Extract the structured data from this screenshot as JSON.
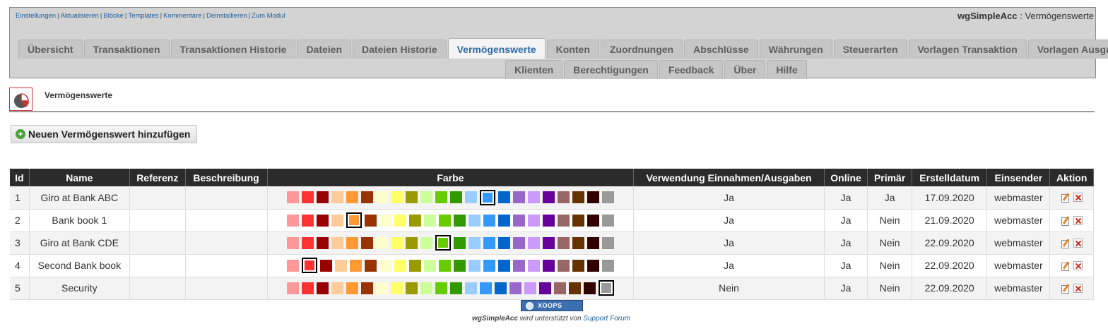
{
  "admin_links": [
    "Einstellungen",
    "Aktualisieren",
    "Blöcke",
    "Templates",
    "Kommentare",
    "Deinstallieren",
    "Zum Modul"
  ],
  "admin_title": {
    "module": "wgSimpleAcc",
    "sep": " : ",
    "page": "Vermögenswerte"
  },
  "tabs_row1": [
    {
      "label": "Übersicht",
      "active": false
    },
    {
      "label": "Transaktionen",
      "active": false
    },
    {
      "label": "Transaktionen Historie",
      "active": false
    },
    {
      "label": "Dateien",
      "active": false
    },
    {
      "label": "Dateien Historie",
      "active": false
    },
    {
      "label": "Vermögenswerte",
      "active": true
    },
    {
      "label": "Konten",
      "active": false
    },
    {
      "label": "Zuordnungen",
      "active": false
    },
    {
      "label": "Abschlüsse",
      "active": false
    },
    {
      "label": "Währungen",
      "active": false
    },
    {
      "label": "Steuerarten",
      "active": false
    },
    {
      "label": "Vorlagen Transaktion",
      "active": false
    },
    {
      "label": "Vorlagen Ausgabe",
      "active": false
    }
  ],
  "tabs_row2": [
    {
      "label": "Klienten"
    },
    {
      "label": "Berechtigungen"
    },
    {
      "label": "Feedback"
    },
    {
      "label": "Über"
    },
    {
      "label": "Hilfe"
    }
  ],
  "module_title": "Vermögenswerte",
  "add_button_label": "Neuen Vermögenswert hinzufügen",
  "table": {
    "headers": [
      "Id",
      "Name",
      "Referenz",
      "Beschreibung",
      "Farbe",
      "Verwendung Einnahmen/Ausgaben",
      "Online",
      "Primär",
      "Erstelldatum",
      "Einsender",
      "Aktion"
    ],
    "palette": [
      "#ff9999",
      "#ff3333",
      "#990000",
      "#ffcc99",
      "#ff9933",
      "#993300",
      "#ffffcc",
      "#ffff66",
      "#999900",
      "#ccff99",
      "#66cc00",
      "#339900",
      "#99ccff",
      "#3399ff",
      "#0066cc",
      "#9966cc",
      "#cc99ff",
      "#660099",
      "#996666",
      "#663300",
      "#330000",
      "#999999"
    ],
    "rows": [
      {
        "id": "1",
        "name": "Giro at Bank ABC",
        "referenz": "",
        "beschreibung": "",
        "selected_color": 13,
        "verwendung": "Ja",
        "online": "Ja",
        "primaer": "Ja",
        "datum": "17.09.2020",
        "einsender": "webmaster"
      },
      {
        "id": "2",
        "name": "Bank book 1",
        "referenz": "",
        "beschreibung": "",
        "selected_color": 4,
        "verwendung": "Ja",
        "online": "Ja",
        "primaer": "Nein",
        "datum": "21.09.2020",
        "einsender": "webmaster"
      },
      {
        "id": "3",
        "name": "Giro at Bank CDE",
        "referenz": "",
        "beschreibung": "",
        "selected_color": 10,
        "verwendung": "Ja",
        "online": "Ja",
        "primaer": "Nein",
        "datum": "22.09.2020",
        "einsender": "webmaster"
      },
      {
        "id": "4",
        "name": "Second Bank book",
        "referenz": "",
        "beschreibung": "",
        "selected_color": 1,
        "verwendung": "Ja",
        "online": "Ja",
        "primaer": "Nein",
        "datum": "22.09.2020",
        "einsender": "webmaster"
      },
      {
        "id": "5",
        "name": "Security",
        "referenz": "",
        "beschreibung": "",
        "selected_color": 21,
        "verwendung": "Nein",
        "online": "Ja",
        "primaer": "Nein",
        "datum": "22.09.2020",
        "einsender": "webmaster"
      }
    ]
  },
  "xoops_badge": "XOOPS",
  "footer": {
    "module": "wgSimpleAcc",
    "text": " wird unterstützt von ",
    "link": "Support Forum"
  }
}
